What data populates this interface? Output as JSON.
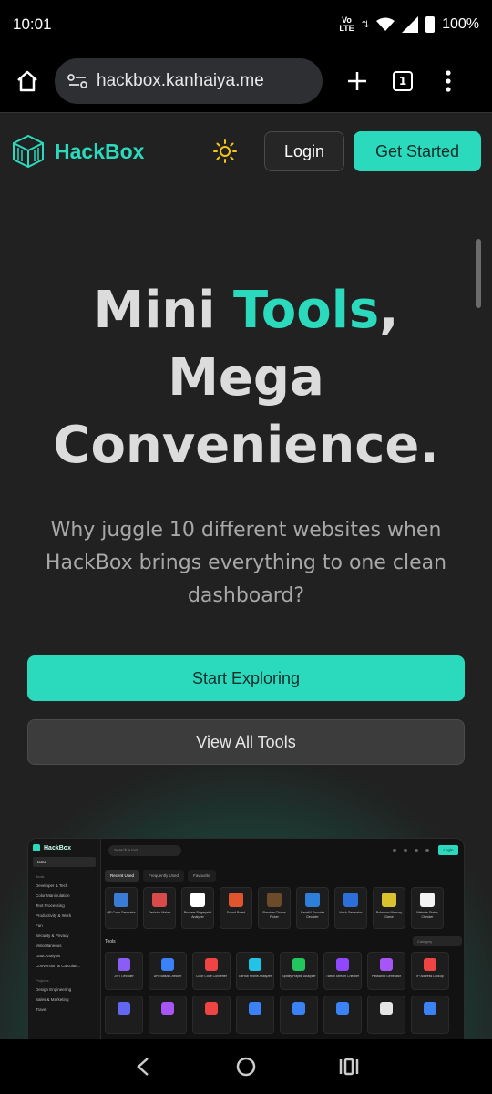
{
  "status": {
    "time": "10:01",
    "network": "VoLTE",
    "battery": "100%"
  },
  "browser": {
    "url": "hackbox.kanhaiya.me",
    "tab_count": "1"
  },
  "header": {
    "logo_text": "HackBox",
    "login_label": "Login",
    "started_label": "Get Started"
  },
  "hero": {
    "title_part1": "Mini ",
    "title_accent": "Tools",
    "title_part2": ",",
    "title_line2": "Mega",
    "title_line3": "Convenience.",
    "subtitle": "Why juggle 10 different websites when HackBox brings everything to one clean dashboard?",
    "explore_label": "Start Exploring",
    "viewall_label": "View All Tools"
  },
  "preview": {
    "logo": "HackBox",
    "search_placeholder": "Search a tool",
    "login": "Login",
    "side_home": "Home",
    "side_tools_header": "Tools",
    "side_items": [
      "Developer & Tech",
      "Color Manipulation",
      "Text Processing",
      "Productivity & Work",
      "Fun",
      "Security & Privacy",
      "Miscellaneous",
      "Data Analysis",
      "Conversion & Calculati..."
    ],
    "side_projects_header": "Projects",
    "side_projects": [
      "Design Engineering",
      "Sales & Marketing",
      "Travel"
    ],
    "tabs": [
      "Recent Used",
      "Frequently Used",
      "Favourite"
    ],
    "recent": [
      {
        "label": "QR Code Generator",
        "color": "#3a7bd5"
      },
      {
        "label": "Decision Maker",
        "color": "#d94a4a"
      },
      {
        "label": "Browser Fingerprint Analyzer",
        "color": "#ffffff"
      },
      {
        "label": "Sound Board",
        "color": "#e0552d"
      },
      {
        "label": "Random Choice Picker",
        "color": "#6b4b2a"
      },
      {
        "label": "Base64 Encoder Decoder",
        "color": "#2d7fd9"
      },
      {
        "label": "Hash Generator",
        "color": "#2d6fd9"
      },
      {
        "label": "Pokemon Memory Game",
        "color": "#d9c22d"
      },
      {
        "label": "Website Status Checker",
        "color": "#f2f2f2"
      }
    ],
    "tools_label": "Tools",
    "category_label": "Category",
    "tools": [
      {
        "label": "JWT Decoder",
        "color": "#8b5cf6"
      },
      {
        "label": "API Status Checker",
        "color": "#3b82f6"
      },
      {
        "label": "Color Code Converter",
        "color": "#ef4444"
      },
      {
        "label": "GitHub Profile Analyzer",
        "color": "#22c3e6"
      },
      {
        "label": "Spotify Playlist Analyzer",
        "color": "#22c55e"
      },
      {
        "label": "Twitch Stream Checker",
        "color": "#9146ff"
      },
      {
        "label": "Password Generator",
        "color": "#a855f7"
      },
      {
        "label": "IP Address Lookup",
        "color": "#ef4444"
      },
      {
        "label": "",
        "color": "#6366f1"
      },
      {
        "label": "",
        "color": "#a855f7"
      },
      {
        "label": "",
        "color": "#ef4444"
      },
      {
        "label": "",
        "color": "#3b82f6"
      },
      {
        "label": "",
        "color": "#3b82f6"
      },
      {
        "label": "",
        "color": "#3b82f6"
      },
      {
        "label": "",
        "color": "#e5e5e5"
      },
      {
        "label": "",
        "color": "#3b82f6"
      }
    ]
  },
  "colors": {
    "accent": "#2bd9bd",
    "background": "#212121"
  }
}
